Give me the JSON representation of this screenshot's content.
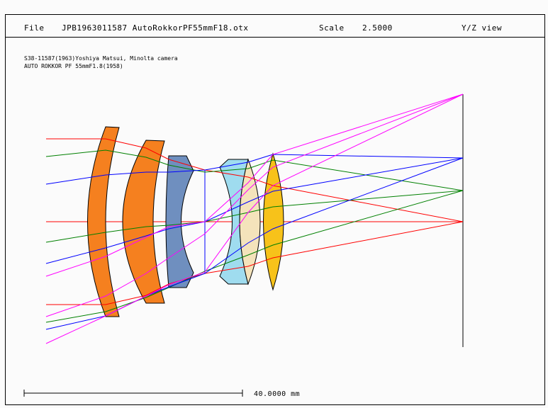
{
  "header": {
    "file_label": "File",
    "file_name": "JPB1963011587 AutoRokkorPF55mmF18.otx",
    "scale_label": "Scale",
    "scale_value": "2.5000",
    "view_label": "Y/Z view"
  },
  "notes": {
    "line1": "S38-11587(1963)Yoshiya Matsui, Minolta camera",
    "line2": "AUTO ROKKOR PF 55mmF1.8(1958)"
  },
  "scale_bar": {
    "label": "40.0000 mm"
  },
  "colors": {
    "lens1": "#f5801f",
    "lens2": "#f5801f",
    "lens3": "#6f8fbf",
    "lens4": "#9fdcef",
    "lens5": "#f4e3bb",
    "lens6": "#f7c21a",
    "ray_red": "#ff0000",
    "ray_green": "#008000",
    "ray_blue": "#0000ff",
    "ray_magenta": "#ff00ff"
  }
}
